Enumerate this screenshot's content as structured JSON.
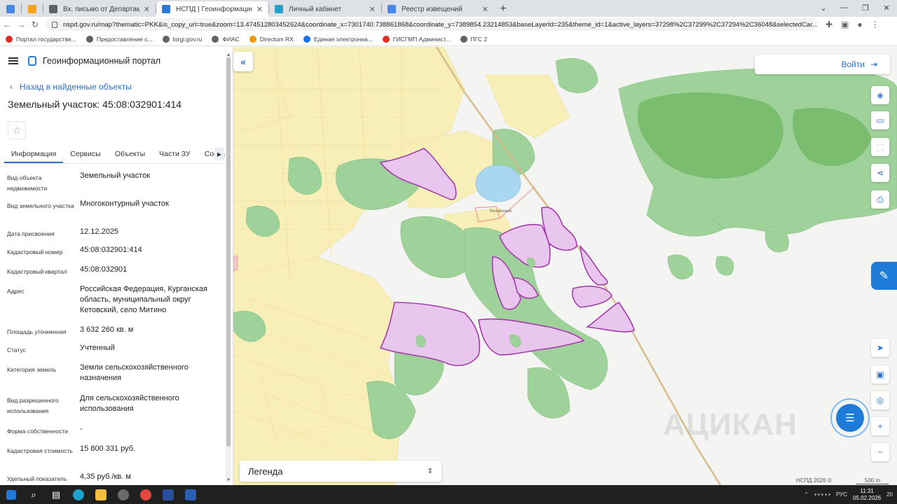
{
  "browser": {
    "tabs": [
      {
        "title": "",
        "icon": "gear-shield-icon",
        "color": "#4a86e8",
        "small": true
      },
      {
        "title": "",
        "icon": "bookmark-icon",
        "color": "#f6a21a",
        "small": true
      },
      {
        "title": "Вх. письмо от Департамент иму",
        "icon": "globe-icon",
        "color": "#5f6368"
      },
      {
        "title": "НСПД | Геоинформационный п",
        "icon": "nspd-icon",
        "color": "#2b7bd6",
        "active": true
      },
      {
        "title": "Личный кабинет",
        "icon": "lk-icon",
        "color": "#27a0c9"
      },
      {
        "title": "Реестр извещений",
        "icon": "registry-icon",
        "color": "#4a86e8"
      }
    ],
    "url": "nspd.gov.ru/map?thematic=PKK&is_copy_url=true&zoom=13.474512803452624&coordinate_x=7301740.738861868&coordinate_y=7389854.23214853&baseLayerId=235&theme_id=1&active_layers=37298%2C37299%2C37294%2C36048&selectedCar...",
    "bookmarks": [
      {
        "label": "Портал государстве...",
        "color": "#d93025"
      },
      {
        "label": "Предоставление с...",
        "color": "#5f6368"
      },
      {
        "label": "torgi.gov.ru",
        "color": "#5f6368"
      },
      {
        "label": "ФИАС",
        "color": "#5f6368"
      },
      {
        "label": "Directum RX",
        "color": "#f29900"
      },
      {
        "label": "Единая электронна...",
        "color": "#1a73e8"
      },
      {
        "label": "ГИСГМП Админист...",
        "color": "#d93025"
      },
      {
        "label": "ПГС 2",
        "color": "#5f6368"
      }
    ]
  },
  "side": {
    "portal_title": "Геоинформационный портал",
    "back_label": "Назад в найденные объекты",
    "object_title": "Земельный участок: 45:08:032901:414",
    "tabs": [
      "Информация",
      "Сервисы",
      "Объекты",
      "Части ЗУ",
      "Соста"
    ],
    "props": [
      {
        "label": "Вид объекта недвижимости",
        "value": "Земельный участок"
      },
      {
        "label": "Вид земельного участка",
        "value": "Многоконтурный участок"
      },
      {
        "label": "Дата присвоения",
        "value": "12.12.2025"
      },
      {
        "label": "Кадастровый номер",
        "value": "45:08:032901:414"
      },
      {
        "label": "Кадастровый квартал",
        "value": "45:08:032901"
      },
      {
        "label": "Адрес",
        "value": "Российская Федерация, Курганская область, муниципальный округ Кетовский, село Митино"
      },
      {
        "label": "Площадь уточненная",
        "value": "3 632 260 кв. м"
      },
      {
        "label": "Статус",
        "value": "Учтенный"
      },
      {
        "label": "Категория земель",
        "value": "Земли сельскохозяйственного назначения"
      },
      {
        "label": "Вид разрешенного использования",
        "value": "Для сельскохозяйственного использования"
      },
      {
        "label": "Форма собственности",
        "value": "-"
      },
      {
        "label": "Кадастровая стоимость",
        "value": "15 800 331 руб."
      },
      {
        "label": "Удельный показатель",
        "value": "4,35 руб./кв. м"
      }
    ]
  },
  "map": {
    "login_label": "Войти",
    "legend_label": "Легенда",
    "copyright": "НСПД 2026 ©",
    "scale_label": "500 m",
    "settlement_label": "Рестайновый",
    "watermark": "АЦИКАН"
  },
  "taskbar": {
    "lang": "РУС",
    "time": "11:31",
    "date": "05.02.2026",
    "notif_count": "20"
  }
}
